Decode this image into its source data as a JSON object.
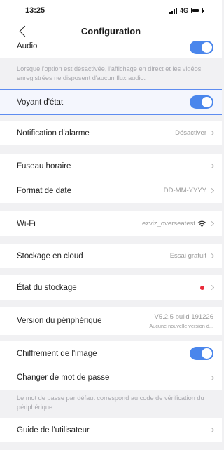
{
  "status_bar": {
    "time": "13:25",
    "network": "4G",
    "battery_level": 0.7
  },
  "nav": {
    "title": "Configuration"
  },
  "rows": {
    "audio": {
      "label": "Audio",
      "toggle_on": true
    },
    "audio_note": "Lorsque l'option est désactivée, l'affichage en direct et les vidéos enregistrées ne disposent d'aucun flux audio.",
    "status_light": {
      "label": "Voyant d'état",
      "toggle_on": true
    },
    "alarm_notification": {
      "label": "Notification d'alarme",
      "value": "Désactiver"
    },
    "timezone": {
      "label": "Fuseau horaire"
    },
    "date_format": {
      "label": "Format de date",
      "value": "DD-MM-YYYY"
    },
    "wifi": {
      "label": "Wi-Fi",
      "value": "ezviz_overseatest"
    },
    "cloud_storage": {
      "label": "Stockage en cloud",
      "value": "Essai gratuit"
    },
    "storage_status": {
      "label": "État du stockage"
    },
    "device_version": {
      "label": "Version du périphérique",
      "value": "V5.2.5 build 191226",
      "sub": "Aucune nouvelle version d..."
    },
    "image_encryption": {
      "label": "Chiffrement de l'image",
      "toggle_on": true
    },
    "change_password": {
      "label": "Changer de mot de passe"
    },
    "password_note": "Le mot de passe par défaut correspond au code de vérification du périphérique.",
    "user_guide": {
      "label": "Guide de l'utilisateur"
    }
  },
  "colors": {
    "accent": "#4a86ec",
    "alert_dot": "#ea2a3a",
    "highlight_border": "#5e8cf0"
  }
}
